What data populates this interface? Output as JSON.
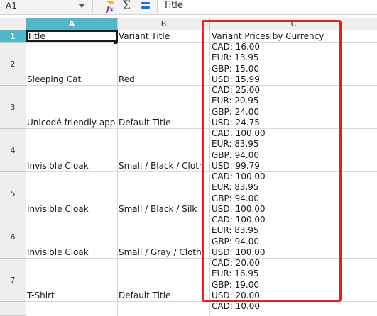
{
  "formula_bar": {
    "name_box": "A1",
    "fx_icon": "function-wizard-icon",
    "sum_icon": "Σ",
    "equals_icon": "formula-icon",
    "content": "Title"
  },
  "columns": [
    "A",
    "B",
    "C"
  ],
  "active_column": "A",
  "rows": [
    {
      "num": "1",
      "a": "Title",
      "b": "Variant Title",
      "c": [
        "Variant Prices by Currency"
      ]
    },
    {
      "num": "2",
      "a": "Sleeping Cat",
      "b": "Red",
      "c": [
        "CAD: 16.00",
        "EUR: 13.95",
        "GBP: 15.00",
        "USD: 15.99"
      ]
    },
    {
      "num": "3",
      "a": "Unicodé friendly app",
      "b": "Default Title",
      "c": [
        "CAD: 25.00",
        "EUR: 20.95",
        "GBP: 24.00",
        "USD: 24.75"
      ]
    },
    {
      "num": "4",
      "a": "Invisible Cloak",
      "b": "Small / Black / Cloth",
      "c": [
        "CAD: 100.00",
        "EUR: 83.95",
        "GBP: 94.00",
        "USD: 99.79"
      ]
    },
    {
      "num": "5",
      "a": "Invisible Cloak",
      "b": "Small / Black / Silk",
      "c": [
        "CAD: 100.00",
        "EUR: 83.95",
        "GBP: 94.00",
        "USD: 100.00"
      ]
    },
    {
      "num": "6",
      "a": "Invisible Cloak",
      "b": "Small / Gray / Cloth",
      "c": [
        "CAD: 100.00",
        "EUR: 83.95",
        "GBP: 94.00",
        "USD: 100.00"
      ]
    },
    {
      "num": "7",
      "a": "T-Shirt",
      "b": "Default Title",
      "c": [
        "CAD: 20.00",
        "EUR: 16.95",
        "GBP: 19.00",
        "USD: 20.00"
      ]
    },
    {
      "num": "",
      "a": "",
      "b": "",
      "c": [
        "CAD: 10.00"
      ]
    }
  ],
  "colors": {
    "accent_header": "#51b7c8",
    "highlight_border": "#e0202a"
  }
}
